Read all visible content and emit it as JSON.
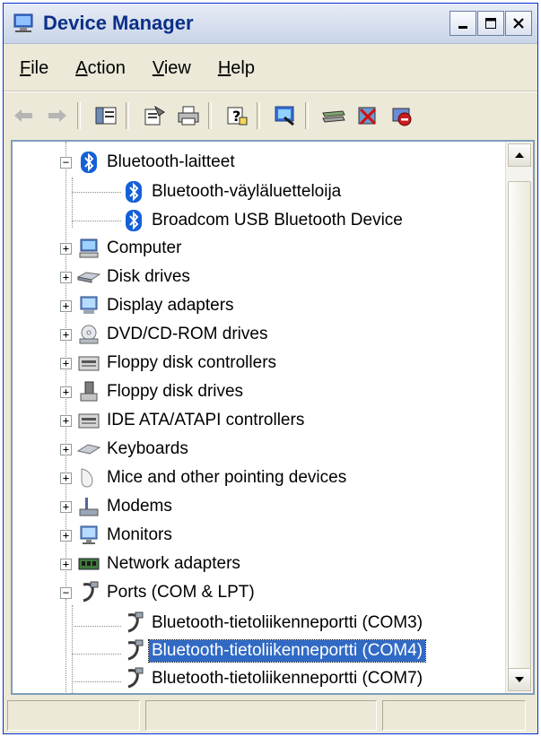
{
  "window": {
    "title": "Device Manager"
  },
  "menu": [
    {
      "pre": "",
      "u": "F",
      "post": "ile"
    },
    {
      "pre": "",
      "u": "A",
      "post": "ction"
    },
    {
      "pre": "",
      "u": "V",
      "post": "iew"
    },
    {
      "pre": "",
      "u": "H",
      "post": "elp"
    }
  ],
  "tree": {
    "bluetooth": "Bluetooth-laitteet",
    "bluetooth_children": [
      "Bluetooth-väyläluetteloija",
      "Broadcom USB Bluetooth Device"
    ],
    "categories": [
      "Computer",
      "Disk drives",
      "Display adapters",
      "DVD/CD-ROM drives",
      "Floppy disk controllers",
      "Floppy disk drives",
      "IDE ATA/ATAPI controllers",
      "Keyboards",
      "Mice and other pointing devices",
      "Modems",
      "Monitors",
      "Network adapters"
    ],
    "ports": "Ports (COM & LPT)",
    "ports_children": [
      "Bluetooth-tietoliikenneportti (COM3)",
      "Bluetooth-tietoliikenneportti (COM4)",
      "Bluetooth-tietoliikenneportti (COM7)"
    ],
    "selected_port": "Bluetooth-tietoliikenneportti (COM4)"
  },
  "icons": {
    "categories": [
      "computer-icon",
      "disk-drive-icon",
      "display-adapter-icon",
      "dvd-drive-icon",
      "floppy-controller-icon",
      "floppy-drive-icon",
      "ide-controller-icon",
      "keyboard-icon",
      "mouse-icon",
      "modem-icon",
      "monitor-icon",
      "network-adapter-icon"
    ]
  }
}
